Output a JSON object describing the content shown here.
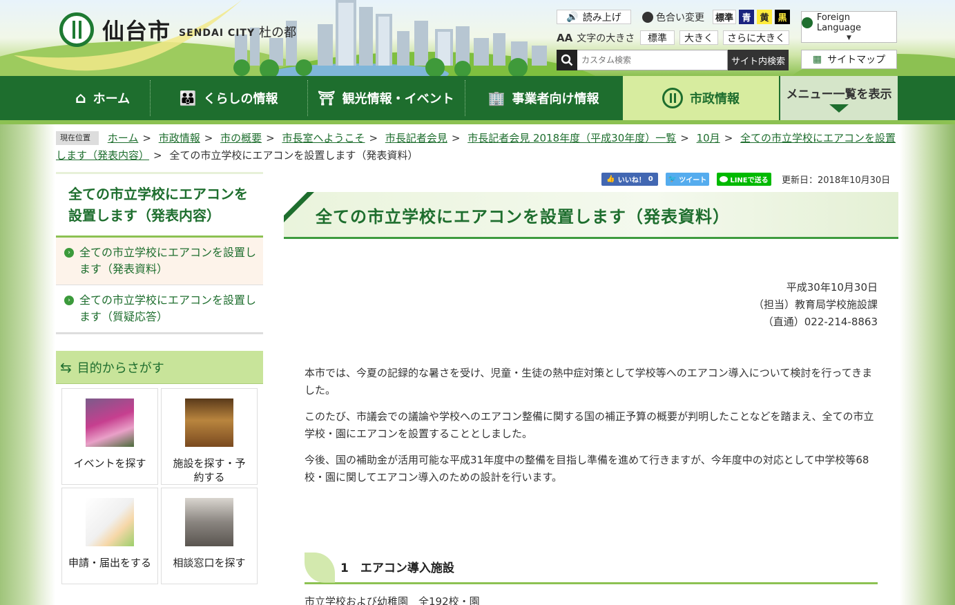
{
  "header": {
    "logo_text": "仙台市",
    "logo_sub": "SENDAI CITY",
    "logo_motto": "杜の都",
    "read_aloud": "読み上げ",
    "color_change": "色合い変更",
    "color_options": [
      "標準",
      "青",
      "黄",
      "黒"
    ],
    "font_size_label": "文字の大きさ",
    "font_size_options": [
      "標準",
      "大きく",
      "さらに大きく"
    ],
    "search_placeholder": "カスタム検索",
    "search_button": "サイト内検索",
    "foreign_language": "Foreign Language",
    "sitemap": "サイトマップ",
    "colors": {
      "nav_green": "#1e6e2e",
      "accent_green": "#8cc152"
    }
  },
  "nav": {
    "items": [
      "ホーム",
      "くらしの情報",
      "観光情報・イベント",
      "事業者向け情報",
      "市政情報"
    ],
    "menu_all": "メニュー一覧を表示"
  },
  "breadcrumb": {
    "here_label": "現在位置",
    "links": [
      "ホーム",
      "市政情報",
      "市の概要",
      "市長室へようこそ",
      "市長記者会見",
      "市長記者会見 2018年度（平成30年度）一覧",
      "10月",
      "全ての市立学校にエアコンを設置します（発表内容）"
    ],
    "current": "全ての市立学校にエアコンを設置します（発表資料）"
  },
  "sidebar": {
    "title": "全ての市立学校にエアコンを設置します（発表内容）",
    "links": [
      "全ての市立学校にエアコンを設置します（発表資料）",
      "全ての市立学校にエアコンを設置します（質疑応答）"
    ],
    "purpose_heading": "目的からさがす",
    "purpose_cards": [
      "イベントを探す",
      "施設を探す・予約する",
      "申請・届出をする",
      "相談窓口を探す"
    ]
  },
  "main": {
    "share_like": "いいね！",
    "share_like_count": "0",
    "share_tweet": "ツイート",
    "share_line": "LINEで送る",
    "updated": "更新日：2018年10月30日",
    "title": "全ての市立学校にエアコンを設置します（発表資料）",
    "meta_date": "平成30年10月30日",
    "meta_dept": "（担当）教育局学校施設課",
    "meta_tel": "（直通）022-214-8863",
    "paragraphs": [
      "本市では、今夏の記録的な暑さを受け、児童・生徒の熱中症対策として学校等へのエアコン導入について検討を行ってきました。",
      "このたび、市議会での議論や学校へのエアコン整備に関する国の補正予算の概要が判明したことなどを踏まえ、全ての市立学校・園にエアコンを設置することとしました。",
      "今後、国の補助金が活用可能な平成31年度中の整備を目指し準備を進めて行きますが、今年度中の対応として中学校等68校・園に関してエアコン導入のための設計を行います。"
    ],
    "section_heading": "1　エアコン導入施設",
    "section_text": "市立学校および幼稚園　全192校・園"
  }
}
